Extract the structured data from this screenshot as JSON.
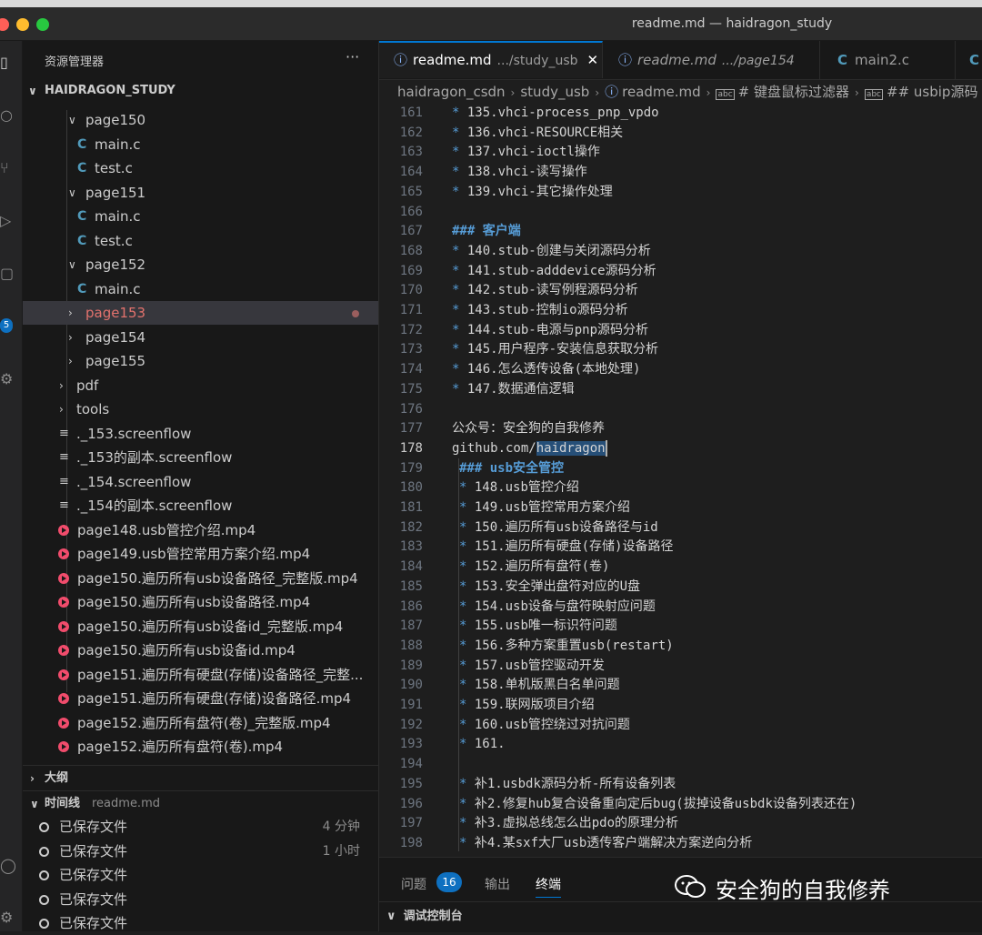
{
  "window": {
    "title": "readme.md — haidragon_study",
    "colors": {
      "close": "#ff5f57",
      "minimize": "#febc2e",
      "maximize": "#28c840"
    }
  },
  "activity_bar": {
    "badge": "5"
  },
  "explorer": {
    "header": "资源管理器",
    "more": "···",
    "root": "HAIDRAGON_STUDY",
    "items": [
      {
        "label": "page150",
        "kind": "folder-open",
        "depth": 2
      },
      {
        "label": "main.c",
        "kind": "c",
        "depth": 3
      },
      {
        "label": "test.c",
        "kind": "c",
        "depth": 3
      },
      {
        "label": "page151",
        "kind": "folder-open",
        "depth": 2
      },
      {
        "label": "main.c",
        "kind": "c",
        "depth": 3
      },
      {
        "label": "test.c",
        "kind": "c",
        "depth": 3
      },
      {
        "label": "page152",
        "kind": "folder-open",
        "depth": 2
      },
      {
        "label": "main.c",
        "kind": "c",
        "depth": 3
      },
      {
        "label": "page153",
        "kind": "folder-closed",
        "depth": 2,
        "selected": true,
        "modified": true
      },
      {
        "label": "page154",
        "kind": "folder-closed",
        "depth": 2
      },
      {
        "label": "page155",
        "kind": "folder-closed",
        "depth": 2
      },
      {
        "label": "pdf",
        "kind": "folder-closed",
        "depth": 1
      },
      {
        "label": "tools",
        "kind": "folder-closed",
        "depth": 1
      },
      {
        "label": "._153.screenflow",
        "kind": "file",
        "depth": 1
      },
      {
        "label": "._153的副本.screenflow",
        "kind": "file",
        "depth": 1
      },
      {
        "label": "._154.screenflow",
        "kind": "file",
        "depth": 1
      },
      {
        "label": "._154的副本.screenflow",
        "kind": "file",
        "depth": 1
      },
      {
        "label": "page148.usb管控介绍.mp4",
        "kind": "video",
        "depth": 1
      },
      {
        "label": "page149.usb管控常用方案介绍.mp4",
        "kind": "video",
        "depth": 1
      },
      {
        "label": "page150.遍历所有usb设备路径_完整版.mp4",
        "kind": "video",
        "depth": 1
      },
      {
        "label": "page150.遍历所有usb设备路径.mp4",
        "kind": "video",
        "depth": 1
      },
      {
        "label": "page150.遍历所有usb设备id_完整版.mp4",
        "kind": "video",
        "depth": 1
      },
      {
        "label": "page150.遍历所有usb设备id.mp4",
        "kind": "video",
        "depth": 1
      },
      {
        "label": "page151.遍历所有硬盘(存储)设备路径_完整...",
        "kind": "video",
        "depth": 1
      },
      {
        "label": "page151.遍历所有硬盘(存储)设备路径.mp4",
        "kind": "video",
        "depth": 1
      },
      {
        "label": "page152.遍历所有盘符(卷)_完整版.mp4",
        "kind": "video",
        "depth": 1
      },
      {
        "label": "page152.遍历所有盘符(卷).mp4",
        "kind": "video",
        "depth": 1
      }
    ],
    "outline_label": "大纲",
    "timeline_label": "时间线",
    "timeline_file": "readme.md",
    "timeline": [
      {
        "label": "已保存文件",
        "time": "4 分钟"
      },
      {
        "label": "已保存文件",
        "time": "1 小时"
      },
      {
        "label": "已保存文件",
        "time": ""
      },
      {
        "label": "已保存文件",
        "time": ""
      },
      {
        "label": "已保存文件",
        "time": ""
      }
    ]
  },
  "tabs": [
    {
      "name": "readme.md",
      "desc": ".../study_usb",
      "active": true,
      "icon": "info-icon"
    },
    {
      "name": "readme.md",
      "desc": ".../page154",
      "active": false,
      "icon": "info-icon"
    },
    {
      "name": "main2.c",
      "desc": "",
      "active": false,
      "icon": "c-icon"
    },
    {
      "name": "",
      "desc": "",
      "active": false,
      "icon": "c-icon"
    }
  ],
  "tab_close": "✕",
  "breadcrumb": [
    "haidragon_csdn",
    "study_usb",
    "readme.md",
    "# 键盘鼠标过滤器",
    "## usbip源码"
  ],
  "editor": {
    "current_line": 178,
    "lines": [
      {
        "n": 161,
        "b": "*",
        "t": " 135.vhci-process_pnp_vpdo"
      },
      {
        "n": 162,
        "b": "*",
        "t": " 136.vhci-RESOURCE相关"
      },
      {
        "n": 163,
        "b": "*",
        "t": " 137.vhci-ioctl操作"
      },
      {
        "n": 164,
        "b": "*",
        "t": " 138.vhci-读写操作"
      },
      {
        "n": 165,
        "b": "*",
        "t": " 139.vhci-其它操作处理"
      },
      {
        "n": 166,
        "b": "",
        "t": ""
      },
      {
        "n": 167,
        "h": "### 客户端"
      },
      {
        "n": 168,
        "b": "*",
        "t": " 140.stub-创建与关闭源码分析"
      },
      {
        "n": 169,
        "b": "*",
        "t": " 141.stub-adddevice源码分析"
      },
      {
        "n": 170,
        "b": "*",
        "t": " 142.stub-读写例程源码分析"
      },
      {
        "n": 171,
        "b": "*",
        "t": " 143.stub-控制io源码分析"
      },
      {
        "n": 172,
        "b": "*",
        "t": " 144.stub-电源与pnp源码分析"
      },
      {
        "n": 173,
        "b": "*",
        "t": " 145.用户程序-安装信息获取分析"
      },
      {
        "n": 174,
        "b": "*",
        "t": " 146.怎么透传设备(本地处理)"
      },
      {
        "n": 175,
        "b": "*",
        "t": " 147.数据通信逻辑"
      },
      {
        "n": 176,
        "b": "",
        "t": ""
      },
      {
        "n": 177,
        "b": "",
        "t": "公众号：安全狗的自我修养"
      },
      {
        "n": 178,
        "b": "",
        "t": "github.com/",
        "s": "haidragon"
      },
      {
        "n": 179,
        "h": "### usb安全管控",
        "in": true
      },
      {
        "n": 180,
        "b": "*",
        "t": " 148.usb管控介绍",
        "in": true
      },
      {
        "n": 181,
        "b": "*",
        "t": " 149.usb管控常用方案介绍",
        "in": true
      },
      {
        "n": 182,
        "b": "*",
        "t": " 150.遍历所有usb设备路径与id",
        "in": true
      },
      {
        "n": 183,
        "b": "*",
        "t": " 151.遍历所有硬盘(存储)设备路径",
        "in": true
      },
      {
        "n": 184,
        "b": "*",
        "t": " 152.遍历所有盘符(卷)",
        "in": true
      },
      {
        "n": 185,
        "b": "*",
        "t": " 153.安全弹出盘符对应的U盘",
        "in": true
      },
      {
        "n": 186,
        "b": "*",
        "t": " 154.usb设备与盘符映射应问题",
        "in": true
      },
      {
        "n": 187,
        "b": "*",
        "t": " 155.usb唯一标识符问题",
        "in": true
      },
      {
        "n": 188,
        "b": "*",
        "t": " 156.多种方案重置usb(restart)",
        "in": true
      },
      {
        "n": 189,
        "b": "*",
        "t": " 157.usb管控驱动开发",
        "in": true
      },
      {
        "n": 190,
        "b": "*",
        "t": " 158.单机版黑白名单问题",
        "in": true
      },
      {
        "n": 191,
        "b": "*",
        "t": " 159.联网版项目介绍",
        "in": true
      },
      {
        "n": 192,
        "b": "*",
        "t": " 160.usb管控绕过对抗问题",
        "in": true
      },
      {
        "n": 193,
        "b": "*",
        "t": " 161.",
        "in": true
      },
      {
        "n": 194,
        "b": "",
        "t": "",
        "in": true
      },
      {
        "n": 195,
        "b": "*",
        "t": " 补1.usbdk源码分析-所有设备列表",
        "in": true
      },
      {
        "n": 196,
        "b": "*",
        "t": " 补2.修复hub复合设备重向定后bug(拔掉设备usbdk设备列表还在)",
        "in": true
      },
      {
        "n": 197,
        "b": "*",
        "t": " 补3.虚拟总线怎么出pdo的原理分析",
        "in": true
      },
      {
        "n": 198,
        "b": "*",
        "t": " 补4.某sxf大厂usb透传客户端解决方案逆向分析",
        "in": true
      }
    ]
  },
  "bottom_panel": {
    "tabs": [
      "问题",
      "输出",
      "终端"
    ],
    "problems_count": "16",
    "debug_console": "调试控制台",
    "watermark": "安全狗的自我修养"
  }
}
